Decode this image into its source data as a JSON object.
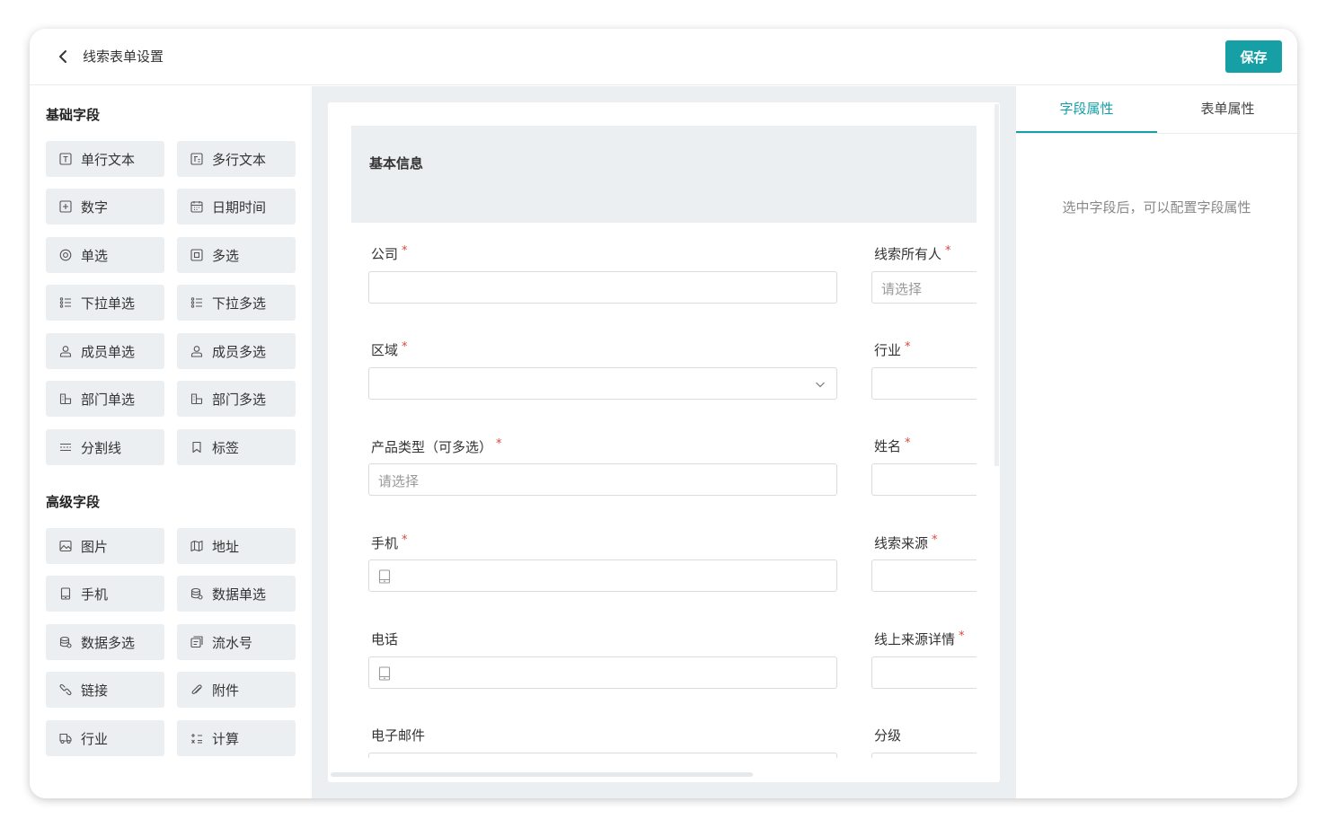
{
  "header": {
    "title": "线索表单设置",
    "save_label": "保存"
  },
  "palette": {
    "basic_title": "基础字段",
    "basic": [
      {
        "label": "单行文本",
        "icon": "text-t-icon"
      },
      {
        "label": "多行文本",
        "icon": "multiline-text-icon"
      },
      {
        "label": "数字",
        "icon": "number-icon"
      },
      {
        "label": "日期时间",
        "icon": "calendar-icon"
      },
      {
        "label": "单选",
        "icon": "radio-icon"
      },
      {
        "label": "多选",
        "icon": "checkbox-icon"
      },
      {
        "label": "下拉单选",
        "icon": "list-icon"
      },
      {
        "label": "下拉多选",
        "icon": "list-icon"
      },
      {
        "label": "成员单选",
        "icon": "user-icon"
      },
      {
        "label": "成员多选",
        "icon": "user-icon"
      },
      {
        "label": "部门单选",
        "icon": "department-icon"
      },
      {
        "label": "部门多选",
        "icon": "department-icon"
      },
      {
        "label": "分割线",
        "icon": "divider-icon"
      },
      {
        "label": "标签",
        "icon": "tag-icon"
      }
    ],
    "advanced_title": "高级字段",
    "advanced": [
      {
        "label": "图片",
        "icon": "image-icon"
      },
      {
        "label": "地址",
        "icon": "map-icon"
      },
      {
        "label": "手机",
        "icon": "phone-icon"
      },
      {
        "label": "数据单选",
        "icon": "database-icon"
      },
      {
        "label": "数据多选",
        "icon": "database-icon"
      },
      {
        "label": "流水号",
        "icon": "serial-icon"
      },
      {
        "label": "链接",
        "icon": "link-icon"
      },
      {
        "label": "附件",
        "icon": "attachment-icon"
      },
      {
        "label": "行业",
        "icon": "truck-icon"
      },
      {
        "label": "计算",
        "icon": "calculate-icon"
      }
    ]
  },
  "form": {
    "group_title": "基本信息",
    "select_placeholder": "请选择",
    "left_fields": [
      {
        "label": "公司",
        "required": "*"
      },
      {
        "label": "区域",
        "required": "*"
      },
      {
        "label": "产品类型（可多选）",
        "required": "*"
      },
      {
        "label": "手机",
        "required": "*"
      },
      {
        "label": "电话",
        "required": ""
      },
      {
        "label": "电子邮件",
        "required": ""
      }
    ],
    "right_fields": [
      {
        "label": "线索所有人",
        "required": "*"
      },
      {
        "label": "行业",
        "required": "*"
      },
      {
        "label": "姓名",
        "required": "*"
      },
      {
        "label": "线索来源",
        "required": "*"
      },
      {
        "label": "线上来源详情",
        "required": "*"
      },
      {
        "label": "分级",
        "required": ""
      }
    ]
  },
  "properties": {
    "tabs": [
      "字段属性",
      "表单属性"
    ],
    "hint": "选中字段后，可以配置字段属性"
  },
  "colors": {
    "accent": "#16a0a6",
    "required": "#e0443e",
    "panel_bg": "#eceff1"
  }
}
